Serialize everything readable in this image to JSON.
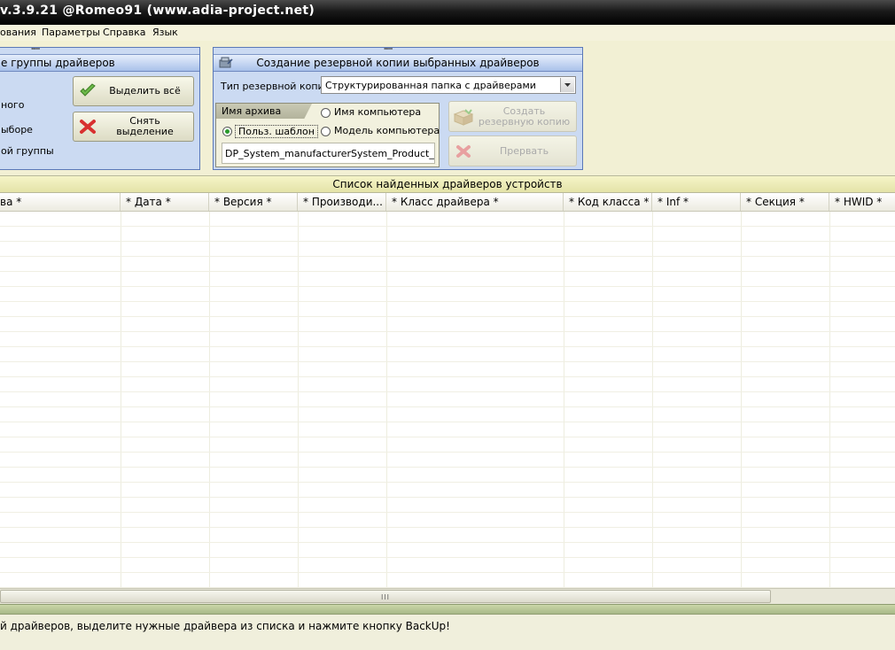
{
  "window": {
    "title": "v.3.9.21 @Romeo91 (www.adia-project.net)"
  },
  "menu": {
    "items": [
      "ования",
      "Параметры",
      "Справка",
      "Язык"
    ]
  },
  "group_panel": {
    "title": "е группы драйверов",
    "options": [
      "ного",
      "ыборе",
      "ой группы"
    ],
    "select_all_button": "Выделить всё",
    "deselect_button": "Снять выделение"
  },
  "backup_panel": {
    "title": "Создание резервной копии выбранных драйверов",
    "backup_type_label": "Тип резервной копии",
    "backup_type_value": "Структурированная папка с драйверами",
    "archive_tab_label": "Имя архива",
    "radio_computer_name": "Имя компьютера",
    "radio_user_template": "Польз. шаблон",
    "radio_computer_model": "Модель компьютера",
    "template_value": "DP_System_manufacturerSystem_Product_Name",
    "create_button": "Создать резервную копию",
    "abort_button": "Прервать"
  },
  "list": {
    "title": "Список найденных драйверов устройств",
    "columns": [
      "ва *",
      "* Дата *",
      "* Версия *",
      "* Производи...",
      "* Класс драйвера *",
      "* Код класса *",
      "* Inf *",
      "* Секция *",
      "* HWID *"
    ],
    "scroll_grip": "III"
  },
  "status": {
    "text": "й драйверов, выделите нужные драйвера из списка и нажмите кнопку BackUp!"
  },
  "colors": {
    "panel": "#cbdaf2",
    "background": "#f0efdc",
    "list_header_band": "#ecebb4",
    "status_divider": "#b8c898"
  }
}
